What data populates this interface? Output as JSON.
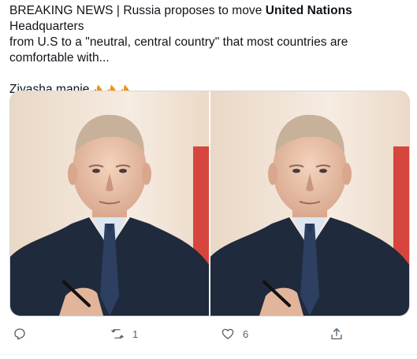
{
  "tweet": {
    "line1_pre": "BREAKING NEWS | Russia proposes to move ",
    "line1_bold": "United Nations",
    "line1_post": " Headquarters",
    "line2": "from U.S to a \"neutral, central country\" that most countries are",
    "line3": "comfortable with...",
    "line4": "Ziyasha manje",
    "emoji": [
      "fire-icon",
      "fire-icon",
      "fire-icon"
    ]
  },
  "media": {
    "images": [
      "portrait-photo",
      "portrait-photo"
    ]
  },
  "actions": {
    "reply_count": "",
    "retweet_count": "1",
    "like_count": "6",
    "share_count": ""
  },
  "colors": {
    "text": "#0f1419",
    "secondary": "#536471",
    "border": "#cfd9de"
  }
}
